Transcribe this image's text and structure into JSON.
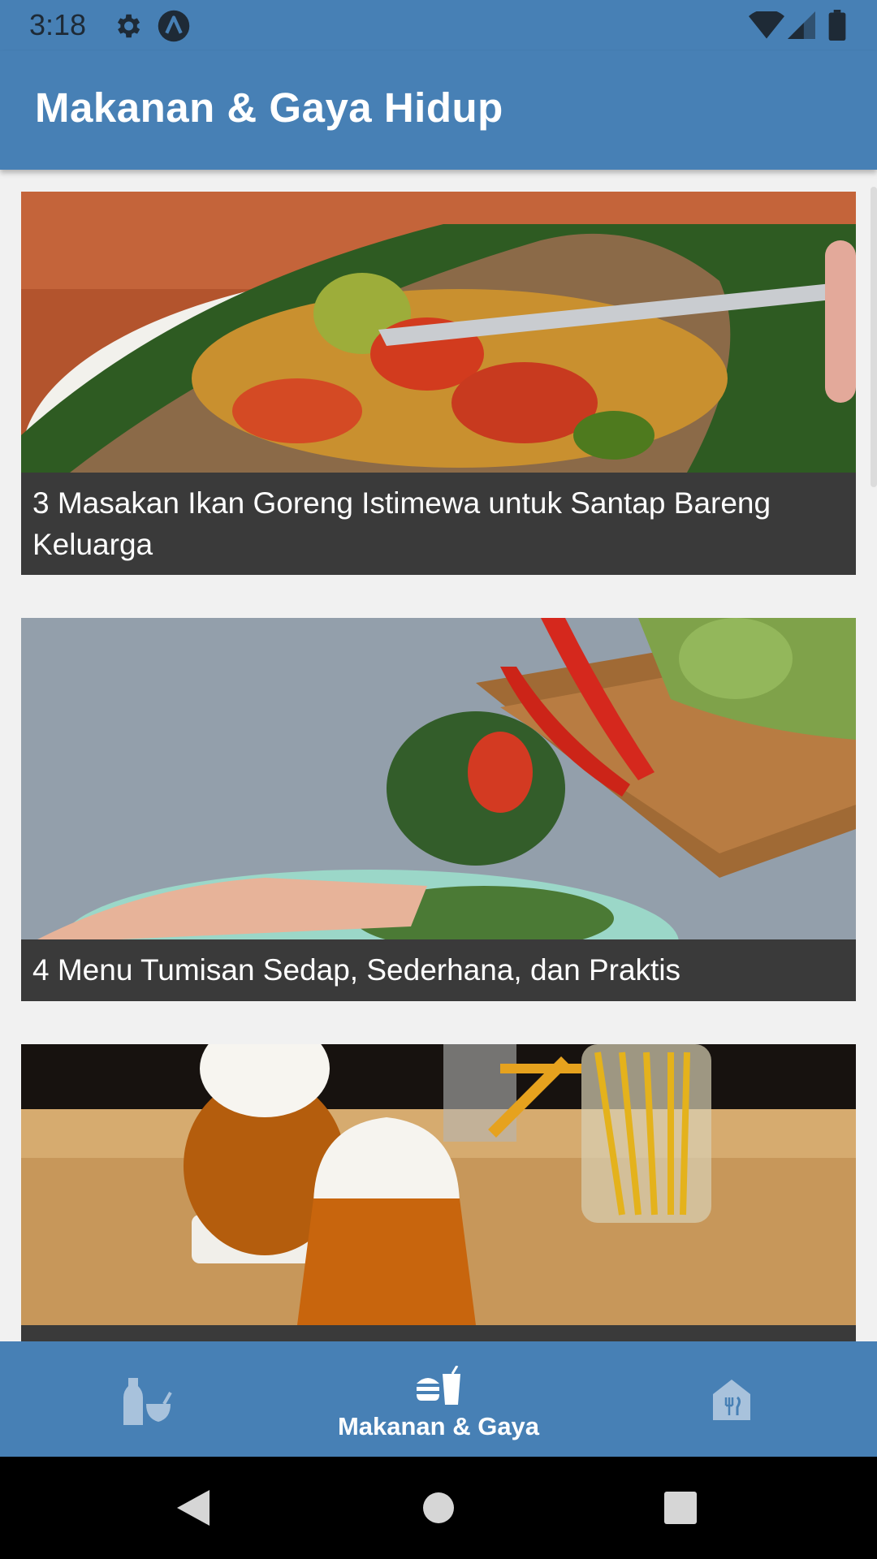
{
  "status_bar": {
    "time": "3:18",
    "icons": [
      "gear-icon",
      "app-a-icon",
      "wifi-icon",
      "signal-icon",
      "battery-icon"
    ]
  },
  "app_bar": {
    "title": "Makanan & Gaya Hidup"
  },
  "articles": [
    {
      "title": "3 Masakan Ikan Goreng Istimewa untuk Santap Bareng Keluarga",
      "image": "fried-fish-image"
    },
    {
      "title": "4 Menu Tumisan Sedap, Sederhana, dan Praktis",
      "image": "stir-fry-vegetables-image"
    },
    {
      "title": "",
      "image": "foamy-drinks-image"
    }
  ],
  "bottom_nav": {
    "items": [
      {
        "icon": "bottle-bowl-icon",
        "label": ""
      },
      {
        "icon": "burger-drink-icon",
        "label": "Makanan & Gaya"
      },
      {
        "icon": "restaurant-icon",
        "label": ""
      }
    ],
    "active_index": 1
  },
  "colors": {
    "primary": "#4780b5",
    "caption_bg": "#3a3a3a",
    "background": "#f1f1f1"
  },
  "system_nav": [
    "back-icon",
    "home-icon",
    "recents-icon"
  ]
}
